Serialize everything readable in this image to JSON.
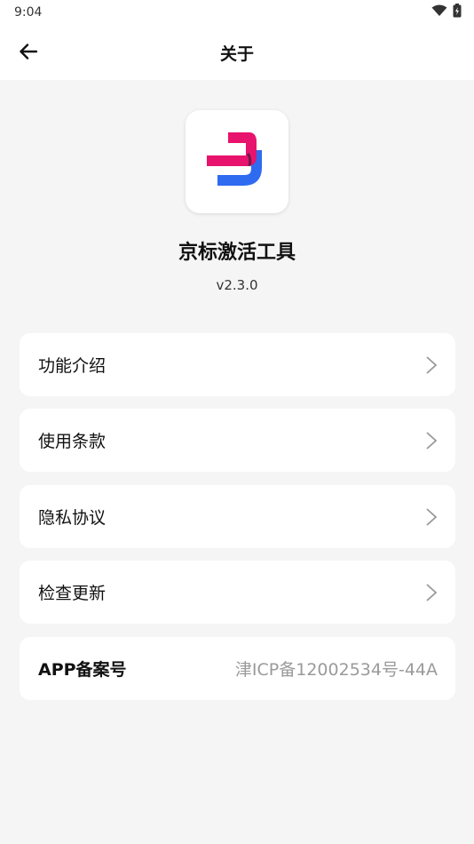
{
  "status_bar": {
    "time": "9:04",
    "icons": [
      "wifi-icon",
      "battery-icon"
    ]
  },
  "header": {
    "title": "关于",
    "back_icon": "arrow-left-icon"
  },
  "app": {
    "name": "京标激活工具",
    "version": "v2.3.0",
    "logo_colors": {
      "magenta": "#e8136c",
      "blue": "#2e6bf0"
    }
  },
  "menu": {
    "items": [
      {
        "label": "功能介绍"
      },
      {
        "label": "使用条款"
      },
      {
        "label": "隐私协议"
      },
      {
        "label": "检查更新"
      }
    ],
    "icp": {
      "label": "APP备案号",
      "value": "津ICP备12002534号-44A"
    }
  }
}
